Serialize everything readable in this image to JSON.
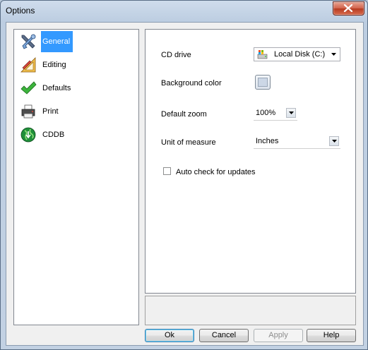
{
  "window": {
    "title": "Options"
  },
  "nav": {
    "items": [
      {
        "label": "General",
        "icon": "tools-icon",
        "selected": true
      },
      {
        "label": "Editing",
        "icon": "ruler-pencil-icon",
        "selected": false
      },
      {
        "label": "Defaults",
        "icon": "checkmark-icon",
        "selected": false
      },
      {
        "label": "Print",
        "icon": "printer-icon",
        "selected": false
      },
      {
        "label": "CDDB",
        "icon": "globe-icon",
        "selected": false
      }
    ]
  },
  "general": {
    "cd_drive_label": "CD drive",
    "cd_drive_value": "Local Disk (C:)",
    "background_color_label": "Background color",
    "default_zoom_label": "Default zoom",
    "default_zoom_value": "100%",
    "unit_label": "Unit of measure",
    "unit_value": "Inches",
    "auto_check_label": "Auto check for updates",
    "auto_check_checked": false
  },
  "buttons": {
    "ok": "Ok",
    "cancel": "Cancel",
    "apply": "Apply",
    "help": "Help"
  },
  "colors": {
    "selection": "#3399ff",
    "close_button": "#c9482f"
  }
}
